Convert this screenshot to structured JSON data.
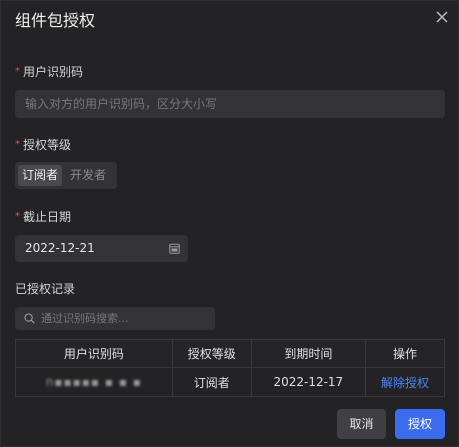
{
  "dialog": {
    "title": "组件包授权"
  },
  "form": {
    "user_id": {
      "required_mark": "*",
      "label": "用户识别码",
      "placeholder": "输入对方的用户识别码，区分大小写",
      "value": ""
    },
    "level": {
      "required_mark": "*",
      "label": "授权等级",
      "options": [
        "订阅者",
        "开发者"
      ],
      "selected": "订阅者"
    },
    "deadline": {
      "required_mark": "*",
      "label": "截止日期",
      "value": "2022-12-21",
      "icon": "calendar-icon"
    }
  },
  "records": {
    "label": "已授权记录",
    "search_placeholder": "通过识别码搜索...",
    "columns": [
      "用户识别码",
      "授权等级",
      "到期时间",
      "操作"
    ],
    "rows": [
      {
        "user_id": "n▪▪▪▪▪ ▪ ▪ ▪",
        "level": "订阅者",
        "expires": "2022-12-17",
        "action": "解除授权"
      }
    ]
  },
  "footer": {
    "cancel_label": "取消",
    "confirm_label": "授权"
  },
  "colors": {
    "accent": "#3b6cf0",
    "link": "#4a86f5",
    "required": "#e5484d",
    "background": "#232325"
  }
}
